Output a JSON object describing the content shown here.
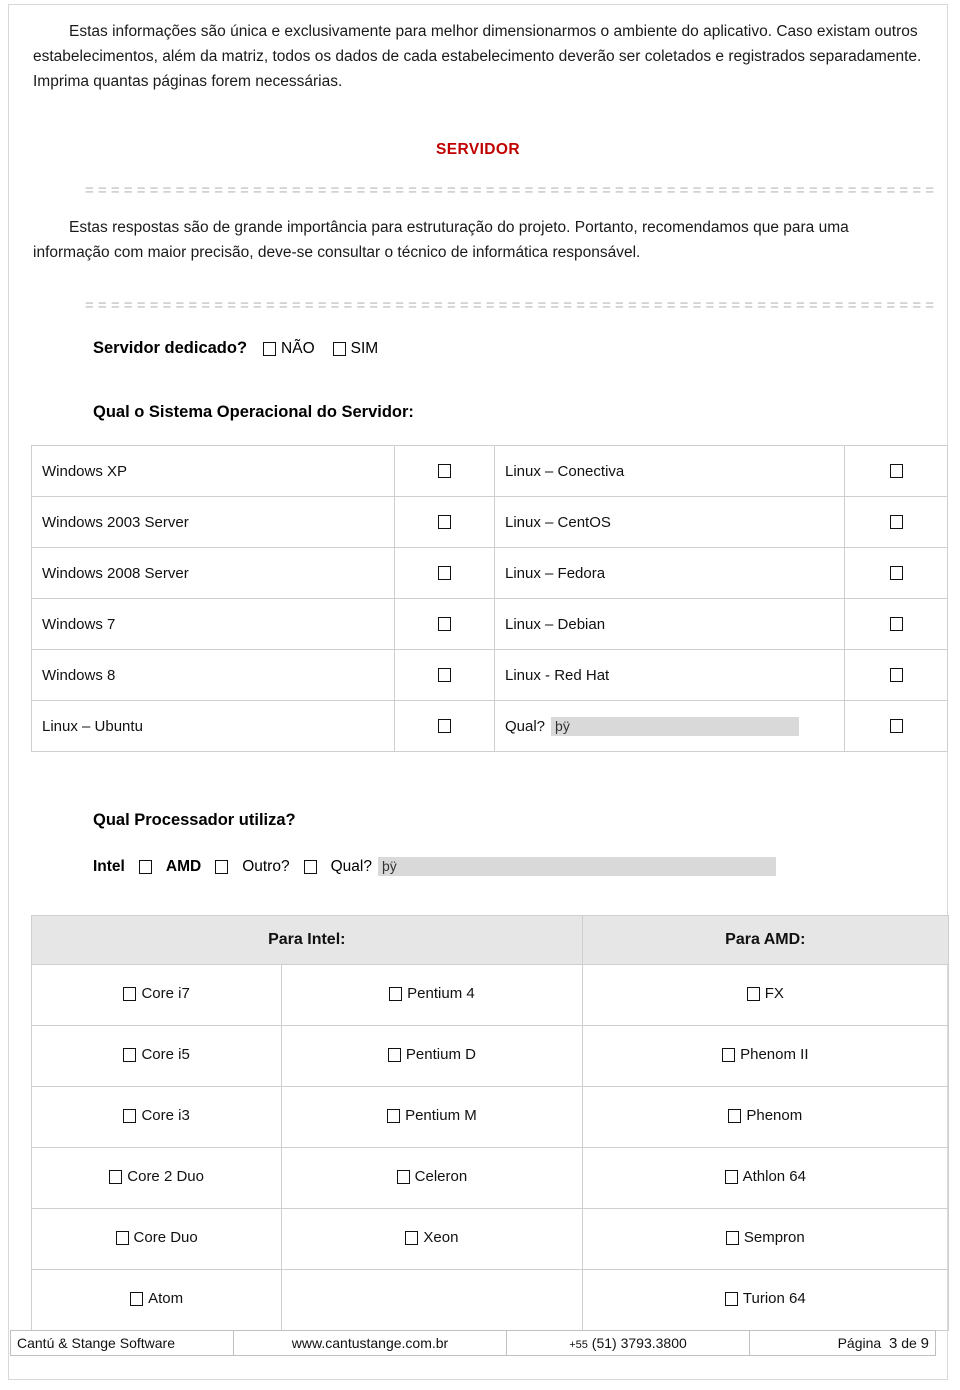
{
  "document": {
    "intro_paragraph": "Estas informações são única e exclusivamente para melhor dimensionarmos o ambiente do aplicativo. Caso existam outros estabelecimentos, além da matriz, todos os dados de cada estabelecimento deverão ser coletados e registrados separadamente. Imprima quantas páginas forem necessárias.",
    "section_heading": "SERVIDOR",
    "heading_color": "#c00000",
    "separator": "= = = = = = = = = = = = = = = = = = = = = = = = = = = = = = = = = = = = = = = = = = = = = = = = = = = = = = = = = = = = = = = = = = = = = = =",
    "importance_paragraph": "Estas respostas são de grande importância para estruturação do projeto. Portanto, recomendamos que para uma informação com maior precisão, deve-se consultar o técnico de informática responsável."
  },
  "dedicated_server": {
    "question": "Servidor dedicado?",
    "options": [
      {
        "label": "NÃO",
        "checked": false
      },
      {
        "label": "SIM",
        "checked": false
      }
    ]
  },
  "os_section": {
    "question": "Qual o Sistema Operacional do Servidor:",
    "rows": [
      {
        "left_label": "Windows XP",
        "left_checked": false,
        "right_label": "Linux – Conectiva",
        "right_checked": false
      },
      {
        "left_label": "Windows 2003 Server",
        "left_checked": false,
        "right_label": "Linux – CentOS",
        "right_checked": false
      },
      {
        "left_label": "Windows 2008 Server",
        "left_checked": false,
        "right_label": "Linux – Fedora",
        "right_checked": false
      },
      {
        "left_label": "Windows 7",
        "left_checked": false,
        "right_label": "Linux – Debian",
        "right_checked": false
      },
      {
        "left_label": "Windows 8",
        "left_checked": false,
        "right_label": "Linux - Red Hat",
        "right_checked": false
      },
      {
        "left_label": "Linux – Ubuntu",
        "left_checked": false,
        "right_label": "Qual?",
        "right_checked": false,
        "right_is_field": true
      }
    ],
    "other_field_value": "þÿ"
  },
  "processor_section": {
    "question": "Qual Processador utiliza?",
    "intel_label": "Intel",
    "amd_label": "AMD",
    "other_label": "Outro?",
    "qual_label": "Qual?",
    "other_field_value": "þÿ",
    "intel_checked": false,
    "amd_checked": false,
    "other_checked": false,
    "headers": {
      "intel": "Para Intel:",
      "amd": "Para AMD:"
    },
    "rows": [
      {
        "intel_a": "Core i7",
        "intel_b": "Pentium 4",
        "amd": "FX",
        "a_checked": false,
        "b_checked": false,
        "amd_checked": false
      },
      {
        "intel_a": "Core i5",
        "intel_b": "Pentium D",
        "amd": "Phenom II",
        "a_checked": false,
        "b_checked": false,
        "amd_checked": false
      },
      {
        "intel_a": "Core i3",
        "intel_b": "Pentium M",
        "amd": "Phenom",
        "a_checked": false,
        "b_checked": false,
        "amd_checked": false
      },
      {
        "intel_a": "Core 2 Duo",
        "intel_b": "Celeron",
        "amd": "Athlon 64",
        "a_checked": false,
        "b_checked": false,
        "amd_checked": false
      },
      {
        "intel_a": "Core Duo",
        "intel_b": "Xeon",
        "amd": "Sempron",
        "a_checked": false,
        "b_checked": false,
        "amd_checked": false
      },
      {
        "intel_a": "Atom",
        "intel_b": "",
        "amd": "Turion 64",
        "a_checked": false,
        "b_checked": false,
        "amd_checked": false
      }
    ]
  },
  "footer": {
    "company": "Cantú & Stange Software",
    "website": "www.cantustange.com.br",
    "phone_prefix": "+55",
    "phone": "(51) 3793.3800",
    "page_label": "Página",
    "page_number": "3",
    "page_of": "de",
    "page_total": "9"
  }
}
